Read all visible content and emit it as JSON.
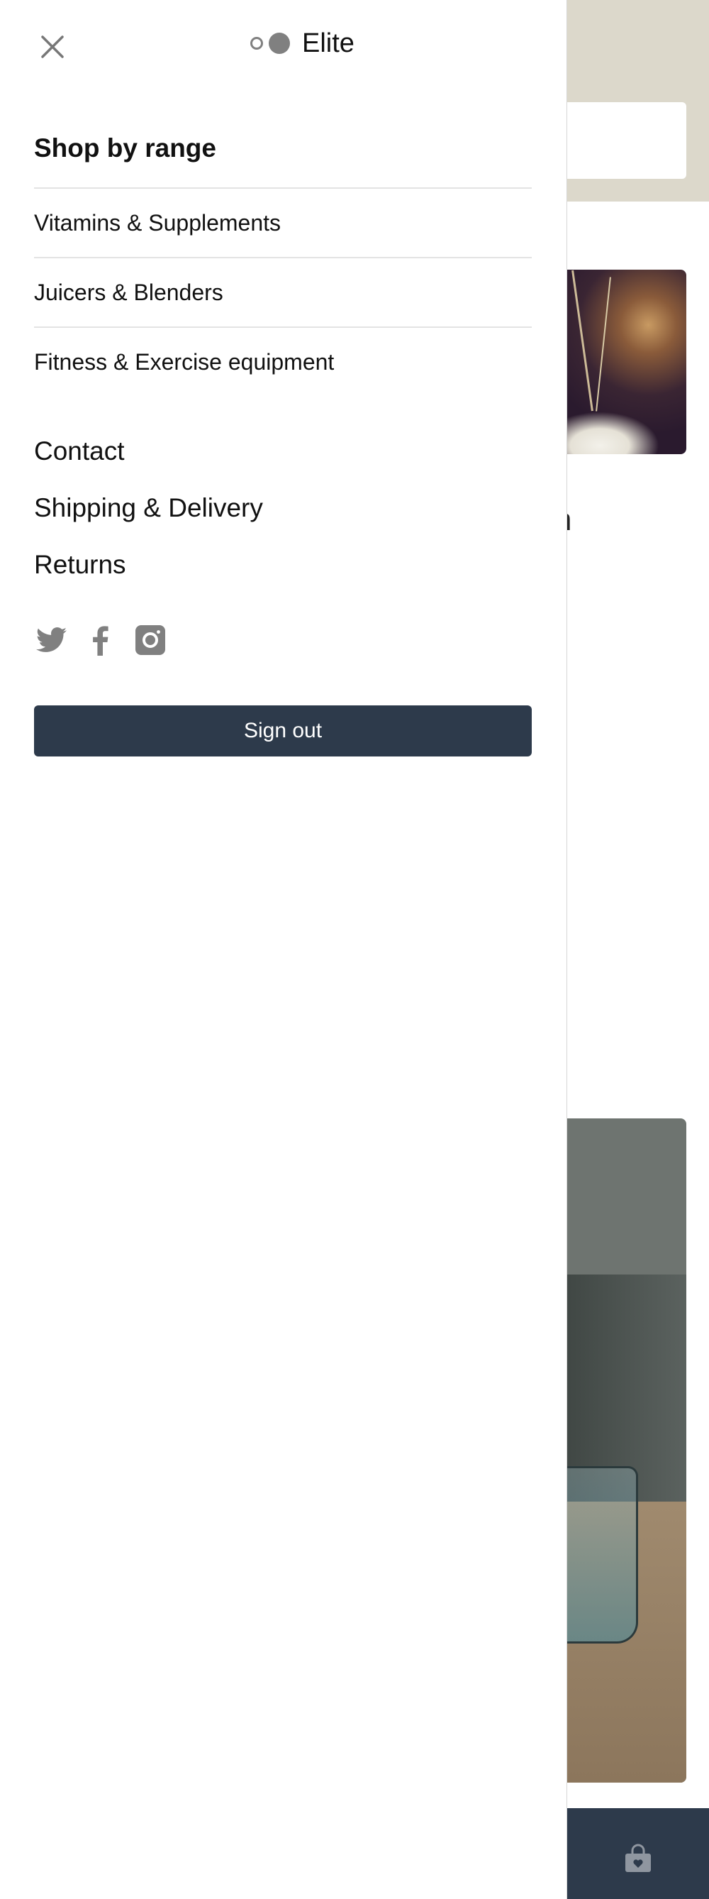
{
  "brand": {
    "name": "Elite"
  },
  "menu": {
    "section_title": "Shop by range",
    "ranges": [
      {
        "label": "Vitamins & Supplements"
      },
      {
        "label": "Juicers & Blenders"
      },
      {
        "label": "Fitness & Exercise equipment"
      }
    ],
    "links": [
      {
        "label": "Contact"
      },
      {
        "label": "Shipping & Delivery"
      },
      {
        "label": "Returns"
      }
    ],
    "social": [
      {
        "icon": "twitter-icon"
      },
      {
        "icon": "facebook-icon"
      },
      {
        "icon": "instagram-icon"
      }
    ],
    "signout_label": "Sign out"
  },
  "background": {
    "heading_fragment": "n",
    "colors": {
      "hero": "#dcd8cb",
      "footer": "#2d3a4b"
    }
  },
  "colors": {
    "button": "#2d3a4b",
    "icon_gray": "#808080",
    "divider": "#e3e3e3"
  }
}
